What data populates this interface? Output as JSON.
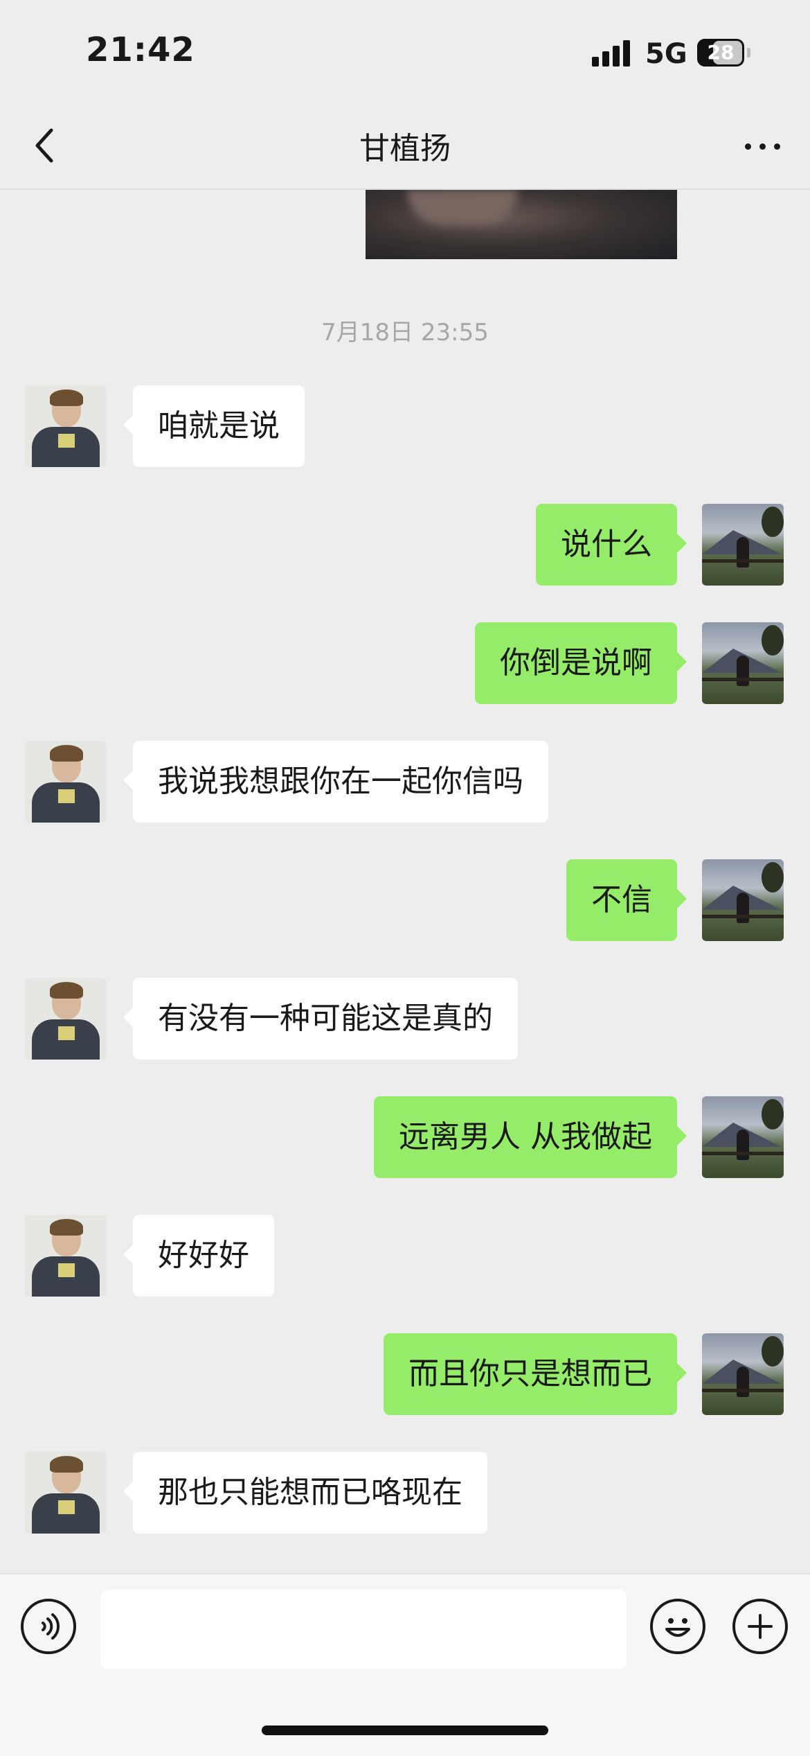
{
  "status_bar": {
    "time": "21:42",
    "network": "5G",
    "battery": "28"
  },
  "header": {
    "title": "甘植扬"
  },
  "chat": {
    "timestamp": "7月18日 23:55",
    "messages": [
      {
        "side": "left",
        "text": "咱就是说"
      },
      {
        "side": "right",
        "text": "说什么"
      },
      {
        "side": "right",
        "text": "你倒是说啊"
      },
      {
        "side": "left",
        "text": "我说我想跟你在一起你信吗"
      },
      {
        "side": "right",
        "text": "不信"
      },
      {
        "side": "left",
        "text": "有没有一种可能这是真的"
      },
      {
        "side": "right",
        "text": "远离男人 从我做起"
      },
      {
        "side": "left",
        "text": "好好好"
      },
      {
        "side": "right",
        "text": "而且你只是想而已"
      },
      {
        "side": "left",
        "text": "那也只能想而已咯现在"
      }
    ]
  },
  "input_bar": {
    "message_value": ""
  },
  "colors": {
    "background": "#ededed",
    "sent_bubble": "#95ec69",
    "received_bubble": "#ffffff"
  },
  "icons": [
    "back-icon",
    "more-icon",
    "voice-icon",
    "emoji-icon",
    "plus-icon"
  ]
}
